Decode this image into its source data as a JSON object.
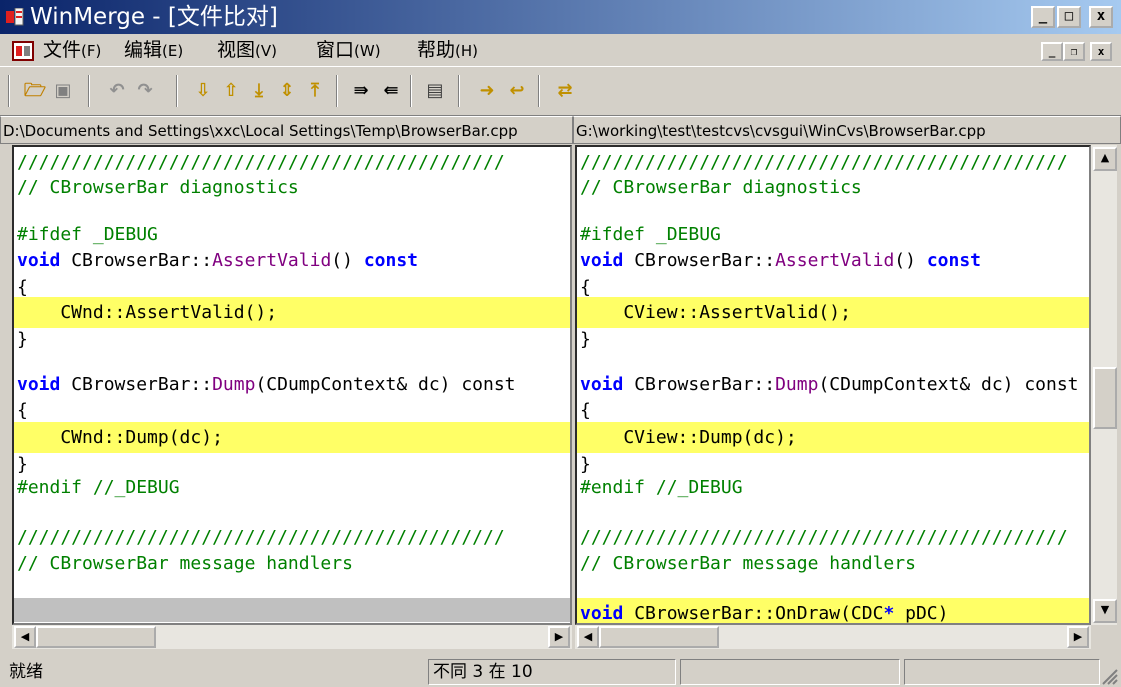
{
  "window": {
    "title": "WinMerge - [文件比对]",
    "minimize_glyph": "_",
    "maximize_glyph": "□",
    "close_glyph": "x"
  },
  "menu": {
    "items": [
      {
        "label": "文件",
        "accel": "(F)"
      },
      {
        "label": "编辑",
        "accel": "(E)"
      },
      {
        "label": "视图",
        "accel": "(V)"
      },
      {
        "label": "窗口",
        "accel": "(W)"
      },
      {
        "label": "帮助",
        "accel": "(H)"
      }
    ],
    "mdi_min": "_",
    "mdi_restore": "❐",
    "mdi_close": "x"
  },
  "toolbar": {
    "icons": [
      "open-icon",
      "save-icon",
      "undo-icon",
      "redo-icon",
      "next-diff-icon",
      "prev-diff-icon",
      "first-diff-icon",
      "current-diff-icon",
      "last-diff-icon",
      "copy-right-icon",
      "copy-left-icon",
      "options-icon",
      "copy-right-advance-icon",
      "copy-left-advance-icon",
      "refresh-icon"
    ]
  },
  "paths": {
    "left": "D:\\Documents and Settings\\xxc\\Local Settings\\Temp\\BrowserBar.cpp",
    "right": "G:\\working\\test\\testcvs\\cvsgui\\WinCvs\\BrowserBar.cpp"
  },
  "left_pane": {
    "lines": [
      {
        "text": "/////////////////////////////////////////////",
        "style": "normal"
      },
      {
        "text": "// CBrowserBar diagnostics",
        "style": "normal"
      },
      {
        "text": "",
        "style": "normal"
      },
      {
        "text": "#ifdef _DEBUG",
        "style": "normal"
      },
      {
        "text": "void CBrowserBar::AssertValid() const",
        "style": "normal"
      },
      {
        "text": "{",
        "style": "normal"
      },
      {
        "text": "    CWnd::AssertValid();",
        "style": "diff"
      },
      {
        "text": "}",
        "style": "normal"
      },
      {
        "text": "",
        "style": "normal"
      },
      {
        "text": "void CBrowserBar::Dump(CDumpContext& dc) const",
        "style": "normal"
      },
      {
        "text": "{",
        "style": "normal"
      },
      {
        "text": "    CWnd::Dump(dc);",
        "style": "diff"
      },
      {
        "text": "}",
        "style": "normal"
      },
      {
        "text": "#endif //_DEBUG",
        "style": "normal"
      },
      {
        "text": "",
        "style": "normal"
      },
      {
        "text": "/////////////////////////////////////////////",
        "style": "normal"
      },
      {
        "text": "// CBrowserBar message handlers",
        "style": "normal"
      },
      {
        "text": "",
        "style": "normal"
      },
      {
        "text": "",
        "style": "missing"
      }
    ]
  },
  "right_pane": {
    "lines": [
      {
        "text": "/////////////////////////////////////////////",
        "style": "normal"
      },
      {
        "text": "// CBrowserBar diagnostics",
        "style": "normal"
      },
      {
        "text": "",
        "style": "normal"
      },
      {
        "text": "#ifdef _DEBUG",
        "style": "normal"
      },
      {
        "text": "void CBrowserBar::AssertValid() const",
        "style": "normal"
      },
      {
        "text": "{",
        "style": "normal"
      },
      {
        "text": "    CView::AssertValid();",
        "style": "diff"
      },
      {
        "text": "}",
        "style": "normal"
      },
      {
        "text": "",
        "style": "normal"
      },
      {
        "text": "void CBrowserBar::Dump(CDumpContext& dc) const",
        "style": "normal"
      },
      {
        "text": "{",
        "style": "normal"
      },
      {
        "text": "    CView::Dump(dc);",
        "style": "diff"
      },
      {
        "text": "}",
        "style": "normal"
      },
      {
        "text": "#endif //_DEBUG",
        "style": "normal"
      },
      {
        "text": "",
        "style": "normal"
      },
      {
        "text": "/////////////////////////////////////////////",
        "style": "normal"
      },
      {
        "text": "// CBrowserBar message handlers",
        "style": "normal"
      },
      {
        "text": "",
        "style": "normal"
      },
      {
        "text": "void CBrowserBar::OnDraw(CDC* pDC)",
        "style": "diff"
      }
    ]
  },
  "scroll": {
    "left_arrow": "◀",
    "right_arrow": "▶",
    "up_arrow": "▲",
    "down_arrow": "▼"
  },
  "status": {
    "ready": "就绪",
    "diff_info": "不同 3 在 10",
    "extra1": "",
    "extra2": ""
  },
  "colors": {
    "diff_highlight": "#ffff66",
    "missing_line": "#c0c0c0",
    "comment": "#008000",
    "keyword": "#0000ff",
    "function": "#800080"
  }
}
